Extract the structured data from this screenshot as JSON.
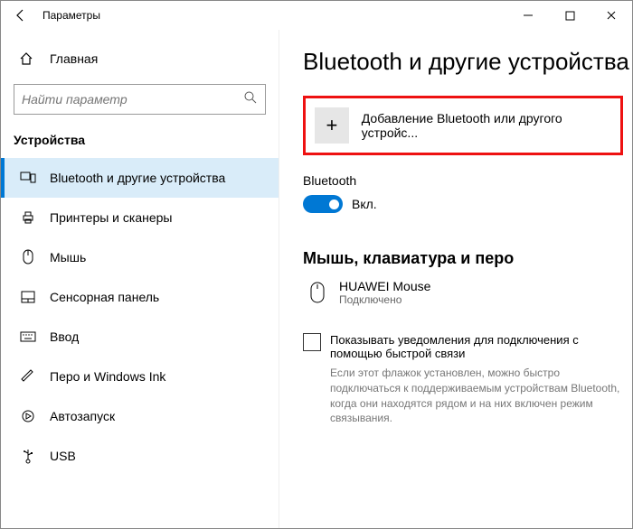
{
  "titlebar": {
    "title": "Параметры"
  },
  "sidebar": {
    "home": "Главная",
    "search_placeholder": "Найти параметр",
    "section": "Устройства",
    "items": [
      {
        "label": "Bluetooth и другие устройства"
      },
      {
        "label": "Принтеры и сканеры"
      },
      {
        "label": "Мышь"
      },
      {
        "label": "Сенсорная панель"
      },
      {
        "label": "Ввод"
      },
      {
        "label": "Перо и Windows Ink"
      },
      {
        "label": "Автозапуск"
      },
      {
        "label": "USB"
      }
    ]
  },
  "content": {
    "heading": "Bluetooth и другие устройства",
    "add_device": "Добавление Bluetooth или другого устройс...",
    "bt_label": "Bluetooth",
    "bt_state": "Вкл.",
    "section2": "Мышь, клавиатура и перо",
    "device": {
      "name": "HUAWEI  Mouse",
      "status": "Подключено"
    },
    "checkbox_label": "Показывать уведомления для подключения с помощью быстрой связи",
    "hint": "Если этот флажок установлен, можно быстро подключаться к поддерживаемым устройствам Bluetooth, когда они находятся рядом и на них включен режим связывания."
  }
}
